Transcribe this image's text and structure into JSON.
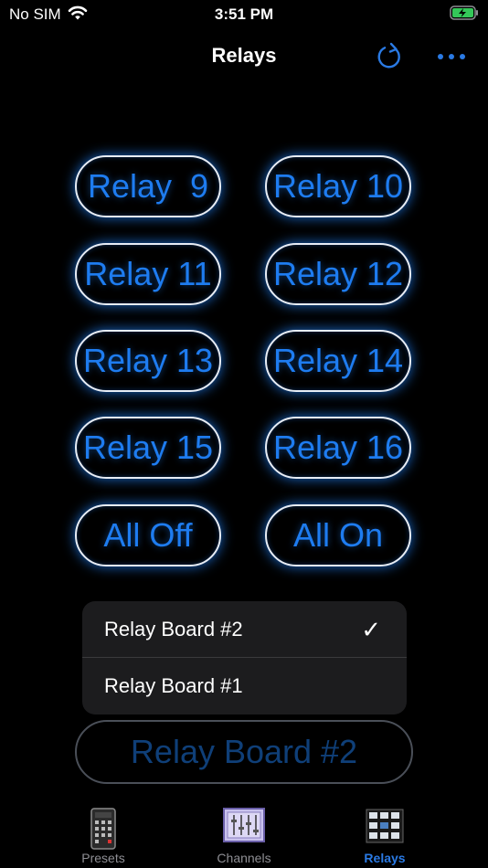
{
  "status_bar": {
    "carrier": "No SIM",
    "time": "3:51 PM"
  },
  "nav": {
    "title": "Relays"
  },
  "relays": [
    "Relay  9",
    "Relay 10",
    "Relay 11",
    "Relay 12",
    "Relay 13",
    "Relay 14",
    "Relay 15",
    "Relay 16",
    "All Off",
    "All On"
  ],
  "menu": {
    "items": [
      {
        "label": "Relay Board #2",
        "selected": true,
        "check": "✓"
      },
      {
        "label": "Relay Board #1",
        "selected": false,
        "check": ""
      }
    ]
  },
  "board_select": {
    "value": "Relay Board #2"
  },
  "tabs": [
    {
      "label": "Presets",
      "active": false
    },
    {
      "label": "Channels",
      "active": false
    },
    {
      "label": "Relays",
      "active": true
    }
  ],
  "colors": {
    "accent": "#1e7cf0",
    "background": "#000000",
    "tab_active": "#2a7ae4"
  }
}
